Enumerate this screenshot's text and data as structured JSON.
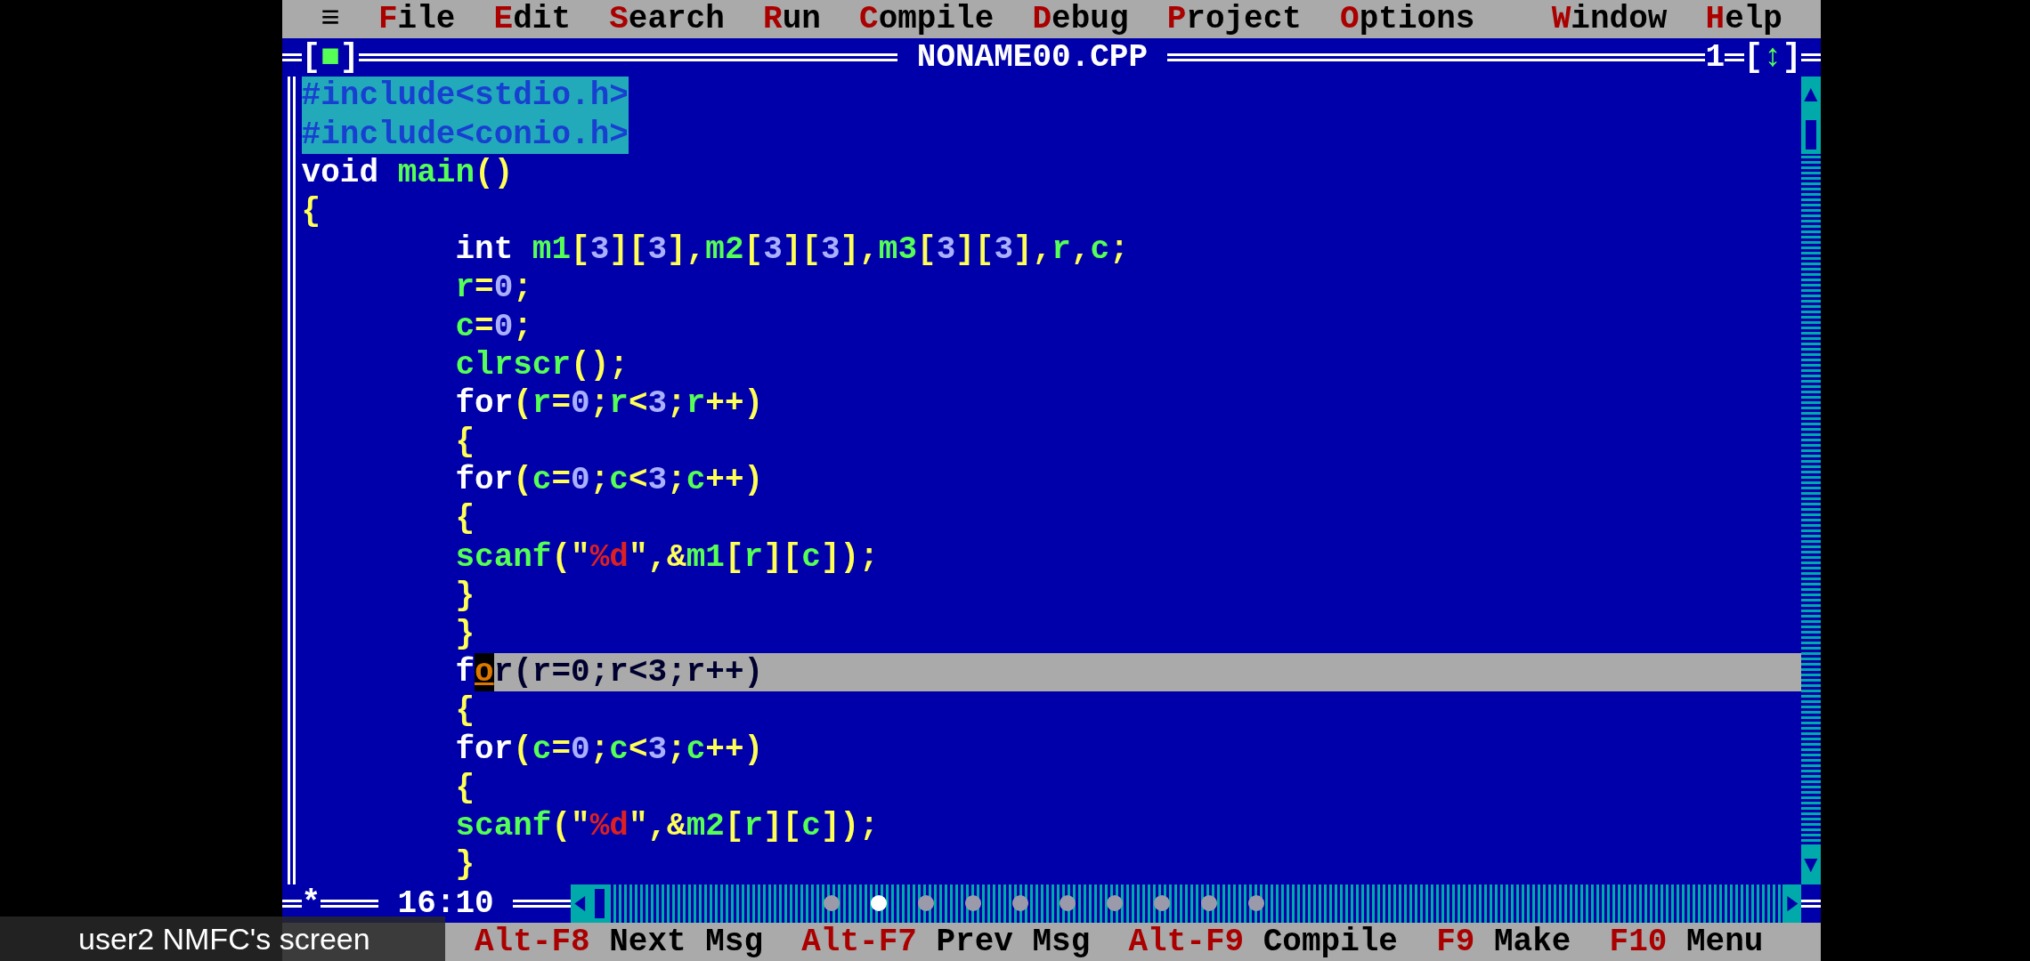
{
  "menu": {
    "system_icon": "≡",
    "items": [
      {
        "label": "File"
      },
      {
        "label": "Edit"
      },
      {
        "label": "Search"
      },
      {
        "label": "Run"
      },
      {
        "label": "Compile"
      },
      {
        "label": "Debug"
      },
      {
        "label": "Project"
      },
      {
        "label": "Options"
      }
    ],
    "right_items": [
      {
        "label": "Window"
      },
      {
        "label": "Help"
      }
    ]
  },
  "editor": {
    "close_button": "[■]",
    "title": "NONAME00.CPP",
    "window_number": "1",
    "zoom_button": "[↕]",
    "modified_mark": "*",
    "position": "16:10",
    "lines": [
      {
        "marked": true,
        "highlighted": false,
        "tokens": [
          {
            "kind": "pre",
            "text": "#include<stdio.h>"
          }
        ]
      },
      {
        "marked": true,
        "highlighted": false,
        "tokens": [
          {
            "kind": "pre",
            "text": "#include<conio.h>"
          }
        ]
      },
      {
        "marked": false,
        "highlighted": false,
        "tokens": [
          {
            "kind": "kw",
            "text": "void "
          },
          {
            "kind": "id",
            "text": "main"
          },
          {
            "kind": "sym",
            "text": "()"
          }
        ]
      },
      {
        "marked": false,
        "highlighted": false,
        "tokens": [
          {
            "kind": "sym",
            "text": "{"
          }
        ]
      },
      {
        "marked": false,
        "highlighted": false,
        "tokens": [
          {
            "kind": "kw",
            "text": "        int "
          },
          {
            "kind": "id",
            "text": "m1"
          },
          {
            "kind": "sym",
            "text": "["
          },
          {
            "kind": "num",
            "text": "3"
          },
          {
            "kind": "sym",
            "text": "]["
          },
          {
            "kind": "num",
            "text": "3"
          },
          {
            "kind": "sym",
            "text": "],"
          },
          {
            "kind": "id",
            "text": "m2"
          },
          {
            "kind": "sym",
            "text": "["
          },
          {
            "kind": "num",
            "text": "3"
          },
          {
            "kind": "sym",
            "text": "]["
          },
          {
            "kind": "num",
            "text": "3"
          },
          {
            "kind": "sym",
            "text": "],"
          },
          {
            "kind": "id",
            "text": "m3"
          },
          {
            "kind": "sym",
            "text": "["
          },
          {
            "kind": "num",
            "text": "3"
          },
          {
            "kind": "sym",
            "text": "]["
          },
          {
            "kind": "num",
            "text": "3"
          },
          {
            "kind": "sym",
            "text": "],"
          },
          {
            "kind": "id",
            "text": "r"
          },
          {
            "kind": "sym",
            "text": ","
          },
          {
            "kind": "id",
            "text": "c"
          },
          {
            "kind": "sym",
            "text": ";"
          }
        ]
      },
      {
        "marked": false,
        "highlighted": false,
        "tokens": [
          {
            "kind": "id",
            "text": "        r"
          },
          {
            "kind": "sym",
            "text": "="
          },
          {
            "kind": "num",
            "text": "0"
          },
          {
            "kind": "sym",
            "text": ";"
          }
        ]
      },
      {
        "marked": false,
        "highlighted": false,
        "tokens": [
          {
            "kind": "id",
            "text": "        c"
          },
          {
            "kind": "sym",
            "text": "="
          },
          {
            "kind": "num",
            "text": "0"
          },
          {
            "kind": "sym",
            "text": ";"
          }
        ]
      },
      {
        "marked": false,
        "highlighted": false,
        "tokens": [
          {
            "kind": "id",
            "text": "        clrscr"
          },
          {
            "kind": "sym",
            "text": "();"
          }
        ]
      },
      {
        "marked": false,
        "highlighted": false,
        "tokens": [
          {
            "kind": "kw",
            "text": "        for"
          },
          {
            "kind": "sym",
            "text": "("
          },
          {
            "kind": "id",
            "text": "r"
          },
          {
            "kind": "sym",
            "text": "="
          },
          {
            "kind": "num",
            "text": "0"
          },
          {
            "kind": "sym",
            "text": ";"
          },
          {
            "kind": "id",
            "text": "r"
          },
          {
            "kind": "sym",
            "text": "<"
          },
          {
            "kind": "num",
            "text": "3"
          },
          {
            "kind": "sym",
            "text": ";"
          },
          {
            "kind": "id",
            "text": "r"
          },
          {
            "kind": "sym",
            "text": "++)"
          }
        ]
      },
      {
        "marked": false,
        "highlighted": false,
        "tokens": [
          {
            "kind": "sym",
            "text": "        {"
          }
        ]
      },
      {
        "marked": false,
        "highlighted": false,
        "tokens": [
          {
            "kind": "kw",
            "text": "        for"
          },
          {
            "kind": "sym",
            "text": "("
          },
          {
            "kind": "id",
            "text": "c"
          },
          {
            "kind": "sym",
            "text": "="
          },
          {
            "kind": "num",
            "text": "0"
          },
          {
            "kind": "sym",
            "text": ";"
          },
          {
            "kind": "id",
            "text": "c"
          },
          {
            "kind": "sym",
            "text": "<"
          },
          {
            "kind": "num",
            "text": "3"
          },
          {
            "kind": "sym",
            "text": ";"
          },
          {
            "kind": "id",
            "text": "c"
          },
          {
            "kind": "sym",
            "text": "++)"
          }
        ]
      },
      {
        "marked": false,
        "highlighted": false,
        "tokens": [
          {
            "kind": "sym",
            "text": "        {"
          }
        ]
      },
      {
        "marked": false,
        "highlighted": false,
        "tokens": [
          {
            "kind": "id",
            "text": "        scanf"
          },
          {
            "kind": "sym",
            "text": "(\""
          },
          {
            "kind": "str",
            "text": "%d"
          },
          {
            "kind": "sym",
            "text": "\",&"
          },
          {
            "kind": "id",
            "text": "m1"
          },
          {
            "kind": "sym",
            "text": "["
          },
          {
            "kind": "id",
            "text": "r"
          },
          {
            "kind": "sym",
            "text": "]["
          },
          {
            "kind": "id",
            "text": "c"
          },
          {
            "kind": "sym",
            "text": "]);"
          }
        ]
      },
      {
        "marked": false,
        "highlighted": false,
        "tokens": [
          {
            "kind": "sym",
            "text": "        }"
          }
        ]
      },
      {
        "marked": false,
        "highlighted": false,
        "tokens": [
          {
            "kind": "sym",
            "text": "        }"
          }
        ]
      },
      {
        "marked": false,
        "highlighted": true,
        "tokens": [
          {
            "kind": "kw",
            "text": "        f"
          },
          {
            "kind": "cursor",
            "text": "o"
          },
          {
            "kind": "kw",
            "text": "r"
          },
          {
            "kind": "sym",
            "text": "("
          },
          {
            "kind": "id",
            "text": "r"
          },
          {
            "kind": "sym",
            "text": "="
          },
          {
            "kind": "num",
            "text": "0"
          },
          {
            "kind": "sym",
            "text": ";"
          },
          {
            "kind": "id",
            "text": "r"
          },
          {
            "kind": "sym",
            "text": "<"
          },
          {
            "kind": "num",
            "text": "3"
          },
          {
            "kind": "sym",
            "text": ";"
          },
          {
            "kind": "id",
            "text": "r"
          },
          {
            "kind": "sym",
            "text": "++)"
          }
        ]
      },
      {
        "marked": false,
        "highlighted": false,
        "tokens": [
          {
            "kind": "sym",
            "text": "        {"
          }
        ]
      },
      {
        "marked": false,
        "highlighted": false,
        "tokens": [
          {
            "kind": "kw",
            "text": "        for"
          },
          {
            "kind": "sym",
            "text": "("
          },
          {
            "kind": "id",
            "text": "c"
          },
          {
            "kind": "sym",
            "text": "="
          },
          {
            "kind": "num",
            "text": "0"
          },
          {
            "kind": "sym",
            "text": ";"
          },
          {
            "kind": "id",
            "text": "c"
          },
          {
            "kind": "sym",
            "text": "<"
          },
          {
            "kind": "num",
            "text": "3"
          },
          {
            "kind": "sym",
            "text": ";"
          },
          {
            "kind": "id",
            "text": "c"
          },
          {
            "kind": "sym",
            "text": "++)"
          }
        ]
      },
      {
        "marked": false,
        "highlighted": false,
        "tokens": [
          {
            "kind": "sym",
            "text": "        {"
          }
        ]
      },
      {
        "marked": false,
        "highlighted": false,
        "tokens": [
          {
            "kind": "id",
            "text": "        scanf"
          },
          {
            "kind": "sym",
            "text": "(\""
          },
          {
            "kind": "str",
            "text": "%d"
          },
          {
            "kind": "sym",
            "text": "\",&"
          },
          {
            "kind": "id",
            "text": "m2"
          },
          {
            "kind": "sym",
            "text": "["
          },
          {
            "kind": "id",
            "text": "r"
          },
          {
            "kind": "sym",
            "text": "]["
          },
          {
            "kind": "id",
            "text": "c"
          },
          {
            "kind": "sym",
            "text": "]);"
          }
        ]
      },
      {
        "marked": false,
        "highlighted": false,
        "tokens": [
          {
            "kind": "sym",
            "text": "        }"
          }
        ]
      }
    ]
  },
  "status_bar": [
    {
      "key": "Alt-F8",
      "label": "Next Msg"
    },
    {
      "key": "Alt-F7",
      "label": "Prev Msg"
    },
    {
      "key": "Alt-F9",
      "label": "Compile"
    },
    {
      "key": "F9",
      "label": "Make"
    },
    {
      "key": "F10",
      "label": "Menu"
    }
  ],
  "page_dots": [
    {
      "selected": false
    },
    {
      "selected": true
    },
    {
      "selected": false
    },
    {
      "selected": false
    },
    {
      "selected": false
    },
    {
      "selected": false
    },
    {
      "selected": false
    },
    {
      "selected": false
    },
    {
      "selected": false
    },
    {
      "selected": false
    }
  ],
  "overlay_label": "user2 NMFC's screen"
}
